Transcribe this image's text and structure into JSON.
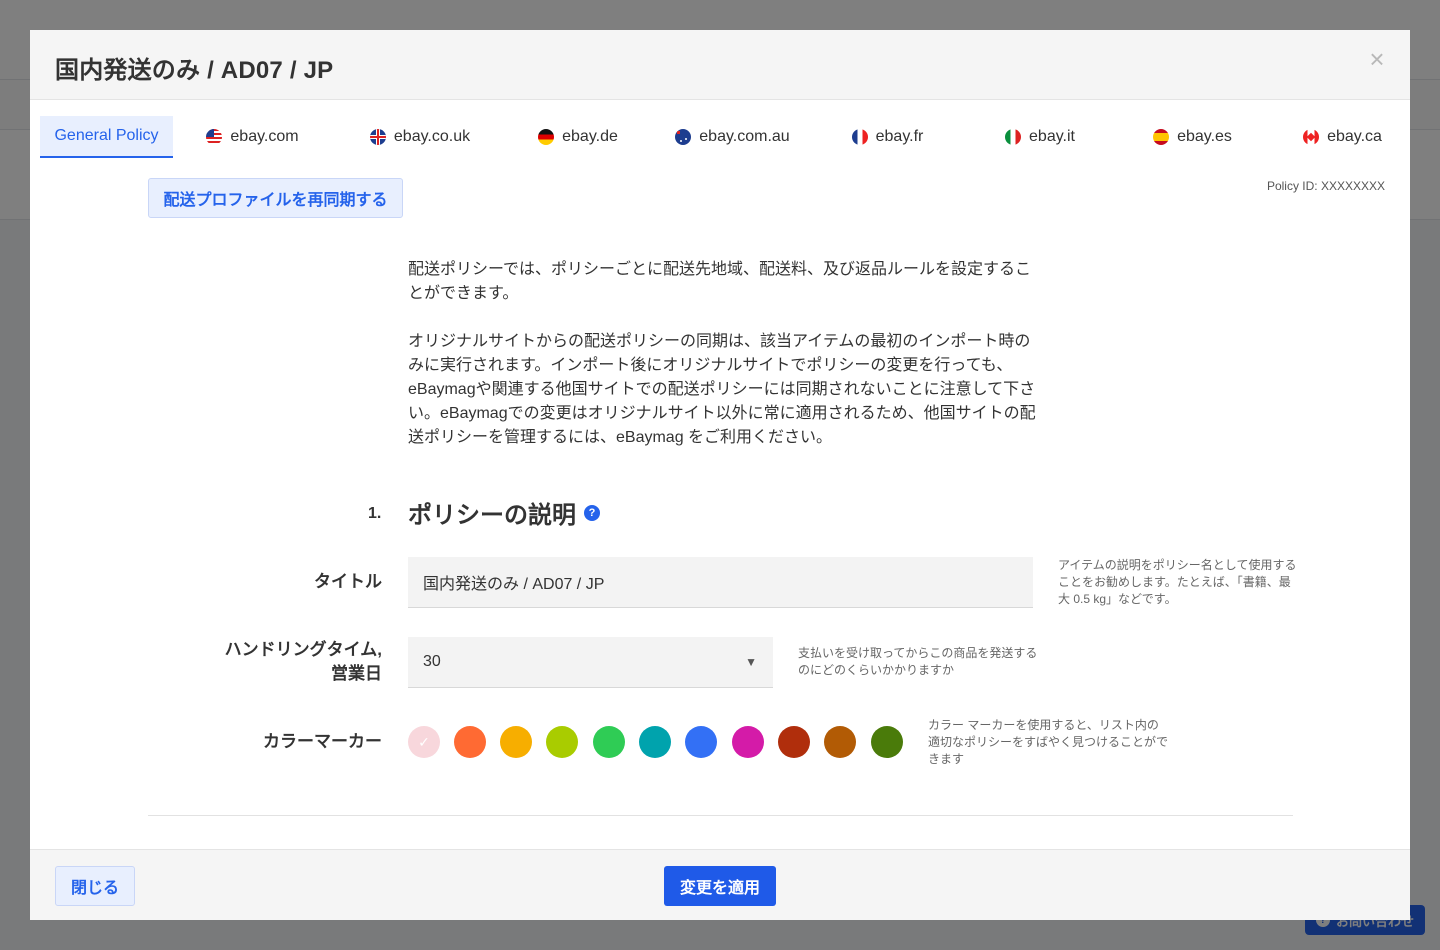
{
  "background": {
    "help_button_label": "お問い合わせ"
  },
  "modal": {
    "title": "国内発送のみ / AD07 / JP",
    "close_icon": "close-icon"
  },
  "tabs": [
    {
      "label": "General Policy",
      "flag": null,
      "active": true
    },
    {
      "label": "ebay.com",
      "flag": "us-flag-icon",
      "active": false
    },
    {
      "label": "ebay.co.uk",
      "flag": "uk-flag-icon",
      "active": false
    },
    {
      "label": "ebay.de",
      "flag": "de-flag-icon",
      "active": false
    },
    {
      "label": "ebay.com.au",
      "flag": "au-flag-icon",
      "active": false
    },
    {
      "label": "ebay.fr",
      "flag": "fr-flag-icon",
      "active": false
    },
    {
      "label": "ebay.it",
      "flag": "it-flag-icon",
      "active": false
    },
    {
      "label": "ebay.es",
      "flag": "es-flag-icon",
      "active": false
    },
    {
      "label": "ebay.ca",
      "flag": "ca-flag-icon",
      "active": false
    }
  ],
  "resync_button_label": "配送プロファイルを再同期する",
  "policy_id": "Policy ID: XXXXXXXX",
  "intro": {
    "paragraph1": "配送ポリシーでは、ポリシーごとに配送先地域、配送料、及び返品ルールを設定することができます。",
    "paragraph2": "オリジナルサイトからの配送ポリシーの同期は、該当アイテムの最初のインポート時のみに実行されます。インポート後にオリジナルサイトでポリシーの変更を行っても、eBaymagや関連する他国サイトでの配送ポリシーには同期されないことに注意して下さい。eBaymagでの変更はオリジナルサイト以外に常に適用されるため、他国サイトの配送ポリシーを管理するには、eBaymag をご利用ください。"
  },
  "section": {
    "number": "1.",
    "title": "ポリシーの説明",
    "help_icon": "?"
  },
  "fields": {
    "title_label": "タイトル",
    "title_value": "国内発送のみ / AD07 / JP",
    "title_hint": "アイテムの説明をポリシー名として使用することをお勧めします。たとえば、「書籍、最大 0.5 kg」などです。",
    "handling_label_line1": "ハンドリングタイム,",
    "handling_label_line2": "営業日",
    "handling_value": "30",
    "handling_hint": "支払いを受け取ってからこの商品を発送するのにどのくらいかかりますか",
    "color_label": "カラーマーカー",
    "color_hint": "カラー マーカーを使用すると、リスト内の適切なポリシーをすばやく見つけることができます"
  },
  "color_markers": [
    {
      "color": "#f8d7dc",
      "selected": true
    },
    {
      "color": "#ff6a33",
      "selected": false
    },
    {
      "color": "#f7ae00",
      "selected": false
    },
    {
      "color": "#a9cc00",
      "selected": false
    },
    {
      "color": "#2fcc55",
      "selected": false
    },
    {
      "color": "#00a3ad",
      "selected": false
    },
    {
      "color": "#3370f5",
      "selected": false
    },
    {
      "color": "#d41ba8",
      "selected": false
    },
    {
      "color": "#b02e0c",
      "selected": false
    },
    {
      "color": "#b25b05",
      "selected": false
    },
    {
      "color": "#4a7b0a",
      "selected": false
    }
  ],
  "footer": {
    "close_label": "閉じる",
    "apply_label": "変更を適用"
  },
  "colors": {
    "accent": "#2563eb",
    "accent_light": "#e8effe"
  }
}
